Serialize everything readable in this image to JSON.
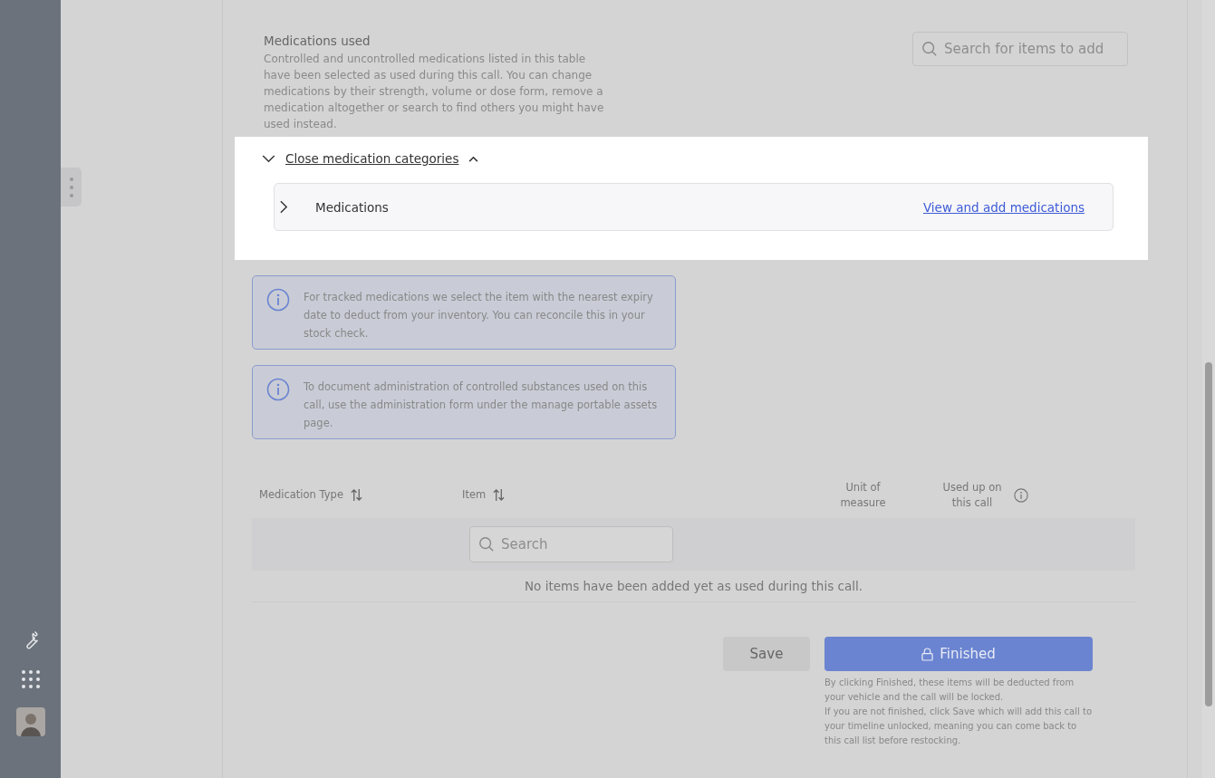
{
  "intro": {
    "title": "Medications used",
    "description": "Controlled and uncontrolled medications listed in this table have been selected as used during this call. You can change medications by their strength, volume or dose form, remove a medication altogether or search to find others you might have used instead."
  },
  "search": {
    "placeholder": "Search for items to add"
  },
  "categories_toggle": {
    "label": "Close medication categories",
    "expanded": true
  },
  "categories": [
    {
      "name": "Medications",
      "expanded": false,
      "link": "View and add medications"
    }
  ],
  "notices": [
    {
      "text": "For tracked medications we select the item with the nearest expiry date to deduct from your inventory. You can reconcile this in your stock check."
    },
    {
      "text": "To document administration of controlled substances used on this call, use the administration form under the manage portable assets page."
    }
  ],
  "table": {
    "columns": [
      {
        "label": "Medication Type",
        "sortable": true,
        "info": false
      },
      {
        "label": "Item",
        "sortable": true,
        "info": false
      },
      {
        "label": "Unit of measure",
        "sortable": false,
        "info": false
      },
      {
        "label": "Used up on this call",
        "sortable": false,
        "info": true
      }
    ],
    "search_placeholder": "Search",
    "empty_message": "No items have been added yet as used during this call."
  },
  "actions": {
    "save": "Save",
    "finish": "Finished",
    "notes": [
      "By clicking Finished, these items will be deducted from your vehicle and the call will be locked.",
      "If you are not finished, click Save which will add this call to your timeline unlocked, meaning you can come back to this call list before restocking."
    ]
  }
}
